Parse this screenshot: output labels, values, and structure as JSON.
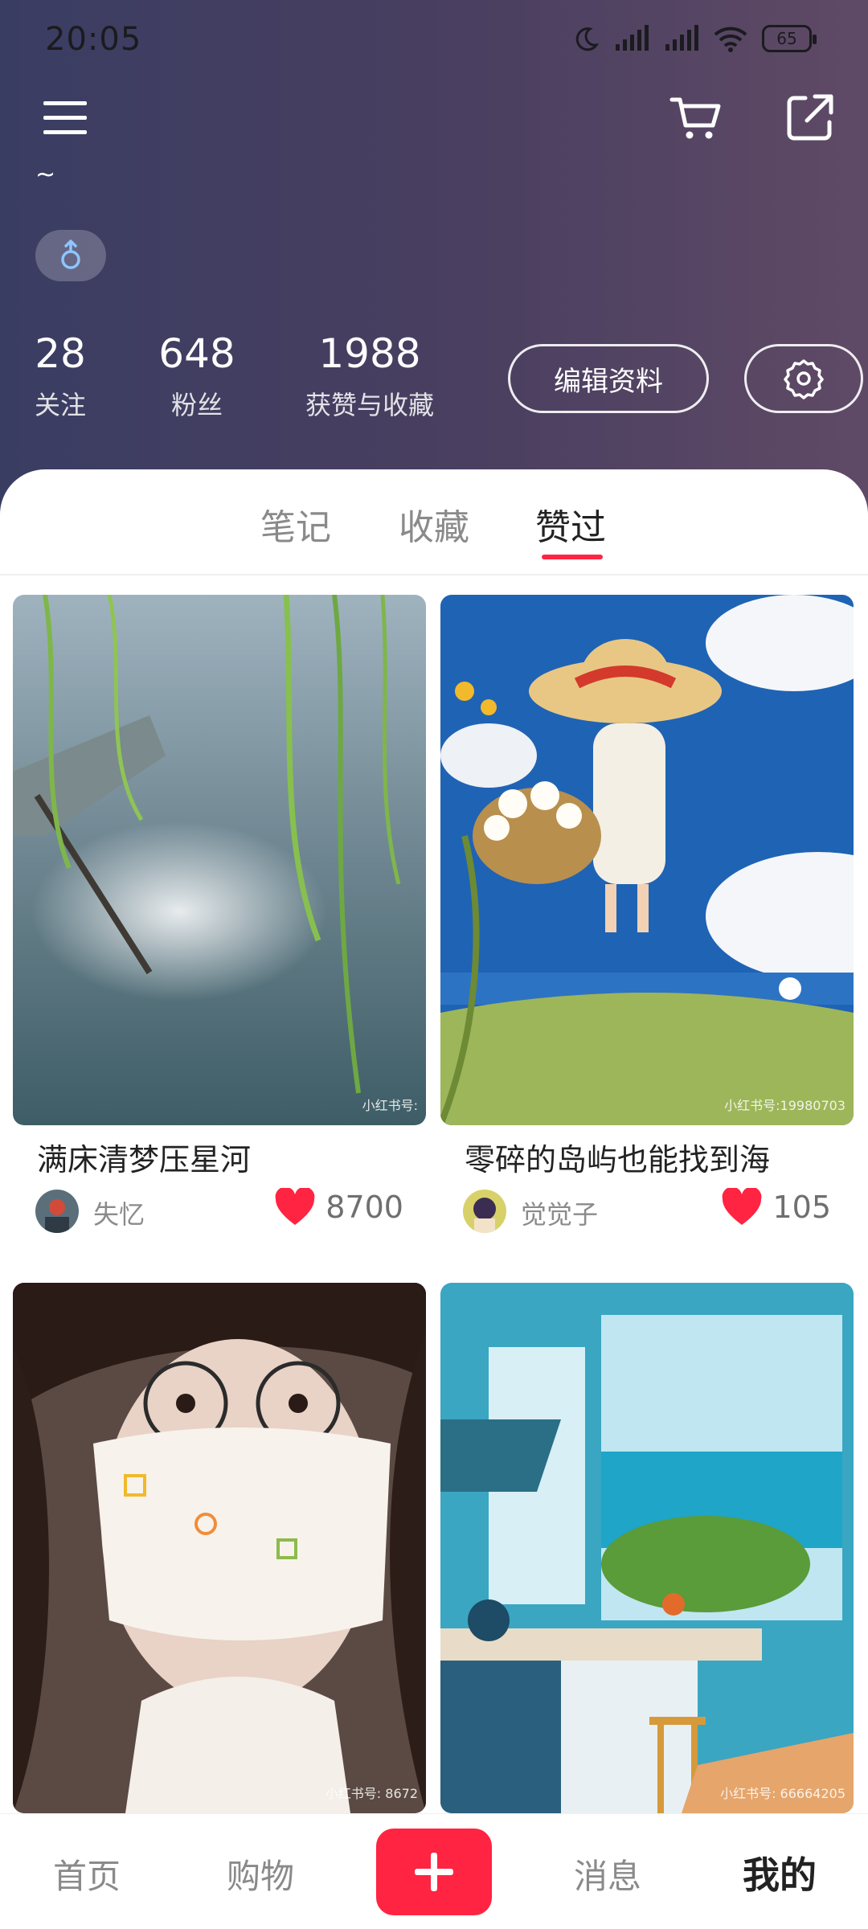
{
  "status_bar": {
    "time": "20:05",
    "battery": "65"
  },
  "profile": {
    "nickname": "~",
    "stats": [
      {
        "value": "28",
        "label": "关注"
      },
      {
        "value": "648",
        "label": "粉丝"
      },
      {
        "value": "1988",
        "label": "获赞与收藏"
      }
    ],
    "edit_label": "编辑资料"
  },
  "tabs": [
    {
      "label": "笔记"
    },
    {
      "label": "收藏"
    },
    {
      "label": "赞过",
      "active": true
    }
  ],
  "cards": [
    {
      "title": "满床清梦压星河",
      "author": "失忆",
      "likes": "8700",
      "watermark": "小红书号:"
    },
    {
      "title": "零碎的岛屿也能找到海",
      "author": "觉觉子",
      "likes": "105",
      "watermark": "小红书号:19980703"
    },
    {
      "title": "",
      "author": "",
      "likes": "",
      "watermark": "小红书号: 8672"
    },
    {
      "title": "",
      "author": "",
      "likes": "",
      "watermark": "小红书号: 66664205"
    }
  ],
  "bottom_nav": {
    "home": "首页",
    "shop": "购物",
    "publish": "+",
    "messages": "消息",
    "me": "我的"
  },
  "colors": {
    "accent": "#ff2442",
    "header_bg": "#3d3f62"
  }
}
